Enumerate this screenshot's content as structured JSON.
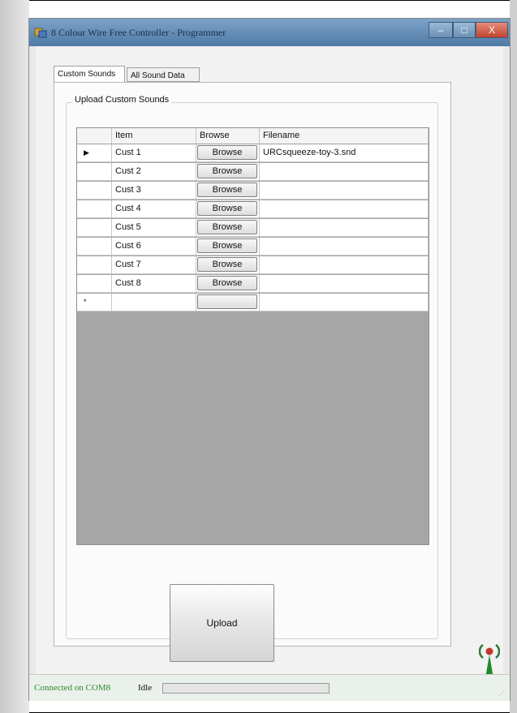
{
  "window": {
    "title": "8 Colour Wire Free Controller - Programmer",
    "min_label": "–",
    "max_label": "□",
    "close_label": "X"
  },
  "tabs": [
    {
      "label": "Custom Sounds",
      "active": true
    },
    {
      "label": "All Sound Data",
      "active": false
    }
  ],
  "group": {
    "title": "Upload Custom Sounds"
  },
  "grid": {
    "headers": {
      "item": "Item",
      "browse": "Browse",
      "filename": "Filename"
    },
    "current_row_marker": "▶",
    "new_row_marker": "*",
    "rows": [
      {
        "item": "Cust 1",
        "browse": "Browse",
        "filename": "URCsqueeze-toy-3.snd"
      },
      {
        "item": "Cust 2",
        "browse": "Browse",
        "filename": ""
      },
      {
        "item": "Cust 3",
        "browse": "Browse",
        "filename": ""
      },
      {
        "item": "Cust 4",
        "browse": "Browse",
        "filename": ""
      },
      {
        "item": "Cust 5",
        "browse": "Browse",
        "filename": ""
      },
      {
        "item": "Cust 6",
        "browse": "Browse",
        "filename": ""
      },
      {
        "item": "Cust 7",
        "browse": "Browse",
        "filename": ""
      },
      {
        "item": "Cust 8",
        "browse": "Browse",
        "filename": ""
      }
    ]
  },
  "upload_label": "Upload",
  "icons": {
    "app": "app-icon",
    "status": "antenna-icon"
  },
  "colors": {
    "titlebar": "#6a93bb",
    "status_text": "#2d8a2d",
    "antenna": "#1f8a2a"
  },
  "status": {
    "connection": "Connected on COM8",
    "state": "Idle",
    "progress": 0
  }
}
